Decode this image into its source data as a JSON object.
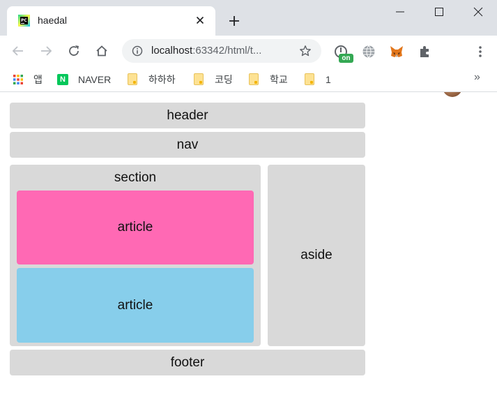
{
  "browser": {
    "tab": {
      "title": "haedal"
    },
    "address": {
      "url_host": "localhost",
      "url_rest": ":63342/html/t..."
    },
    "extension_badge": "on",
    "bookmarks": [
      {
        "label": "앱",
        "icon": "apps-grid-icon"
      },
      {
        "label": "NAVER",
        "icon": "naver-icon",
        "icon_letter": "N"
      },
      {
        "label": "하하하",
        "icon": "folder-icon"
      },
      {
        "label": "코딩",
        "icon": "folder-icon"
      },
      {
        "label": "학교",
        "icon": "folder-icon"
      },
      {
        "label": "1",
        "icon": "folder-icon"
      }
    ],
    "overflow_label": "»"
  },
  "page": {
    "header": "header",
    "nav": "nav",
    "section": "section",
    "articles": [
      "article",
      "article"
    ],
    "aside": "aside",
    "footer": "footer"
  },
  "colors": {
    "box_bg": "#d9d9d9",
    "article_1_bg": "#ff69b4",
    "article_2_bg": "#87ceeb",
    "titlebar_bg": "#dee1e6"
  }
}
